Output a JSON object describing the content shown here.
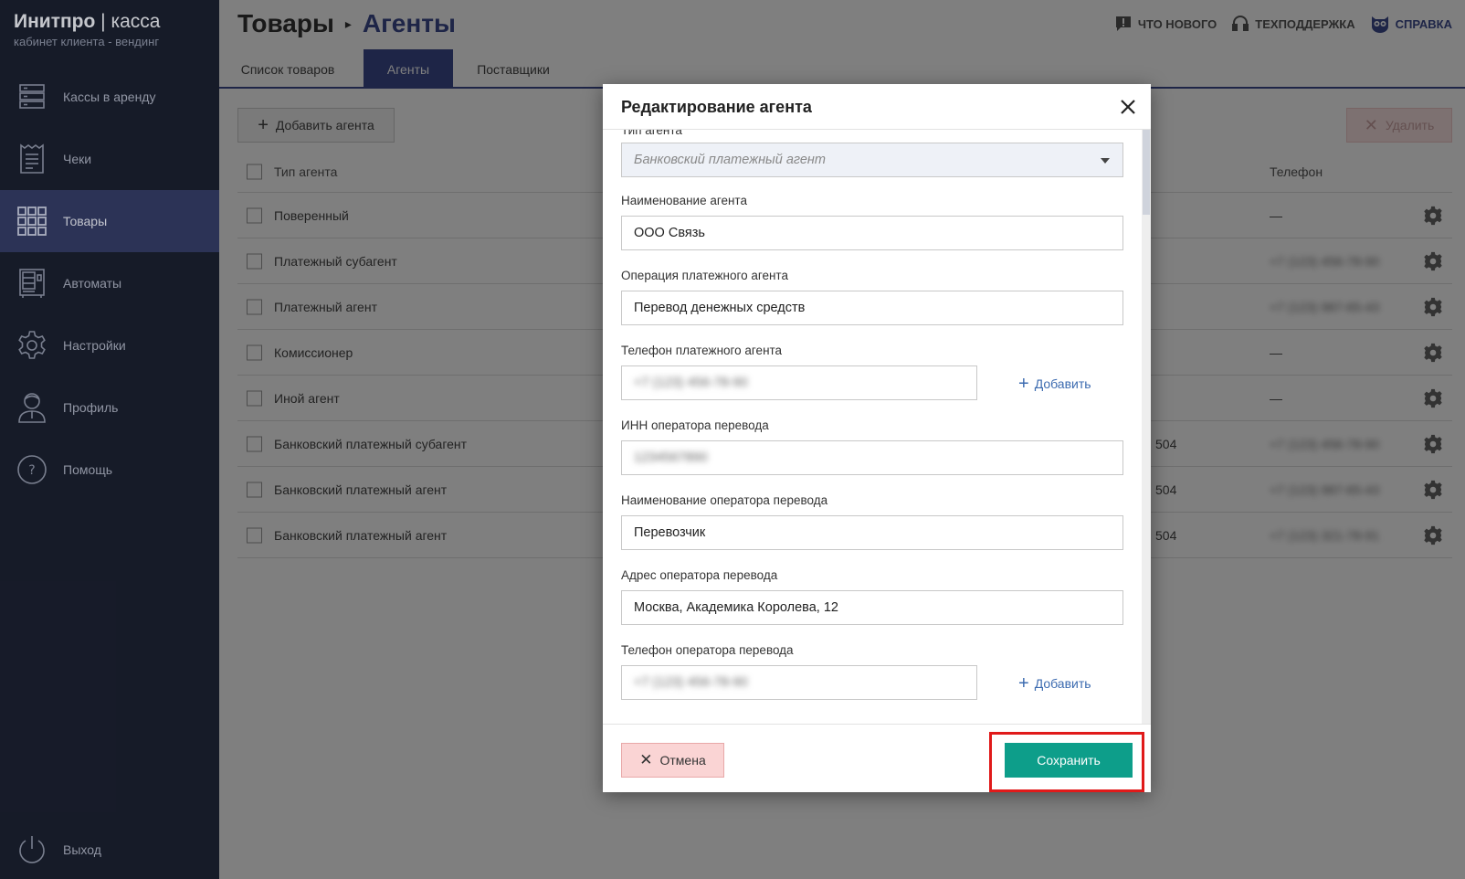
{
  "brand": {
    "name": "Инитпро",
    "sep": "|",
    "product": "касса",
    "subtitle": "кабинет клиента - вендинг"
  },
  "sidebar": {
    "items": [
      {
        "label": "Кассы в аренду",
        "icon": "server-icon"
      },
      {
        "label": "Чеки",
        "icon": "receipt-icon"
      },
      {
        "label": "Товары",
        "icon": "grid-icon"
      },
      {
        "label": "Автоматы",
        "icon": "vending-machine-icon"
      },
      {
        "label": "Настройки",
        "icon": "gear-icon"
      },
      {
        "label": "Профиль",
        "icon": "user-icon"
      },
      {
        "label": "Помощь",
        "icon": "help-icon"
      }
    ],
    "logout": "Выход"
  },
  "header": {
    "section": "Товары",
    "page": "Агенты",
    "links": {
      "news": "ЧТО НОВОГО",
      "support": "ТЕХПОДДЕРЖКА",
      "help": "СПРАВКА"
    }
  },
  "tabs": [
    "Список товаров",
    "Агенты",
    "Поставщики"
  ],
  "toolbar": {
    "add": "Добавить агента",
    "delete": "Удалить"
  },
  "table": {
    "headers": {
      "type": "Тип агента",
      "phone": "Телефон"
    },
    "rows": [
      {
        "type": "Поверенный",
        "code": "",
        "phone": "—"
      },
      {
        "type": "Платежный субагент",
        "code": "",
        "phone": "+7 (123) 456-78-90"
      },
      {
        "type": "Платежный агент",
        "code": "",
        "phone": "+7 (123) 987-65-43"
      },
      {
        "type": "Комиссионер",
        "code": "",
        "phone": "—"
      },
      {
        "type": "Иной агент",
        "code": "",
        "phone": "—"
      },
      {
        "type": "Банковский платежный субагент",
        "code": "504",
        "phone": "+7 (123) 456-78-90"
      },
      {
        "type": "Банковский платежный агент",
        "code": "504",
        "phone": "+7 (123) 987-65-43"
      },
      {
        "type": "Банковский платежный агент",
        "code": "504",
        "phone": "+7 (123) 321-78-91"
      }
    ]
  },
  "modal": {
    "title": "Редактирование агента",
    "agent_type_label": "Тип агента",
    "agent_type_value": "Банковский платежный агент",
    "name_label": "Наименование агента",
    "name_value": "ООО Связь",
    "operation_label": "Операция платежного агента",
    "operation_value": "Перевод денежных средств",
    "agent_phone_label": "Телефон платежного агента",
    "agent_phone_value": "+7 (123) 456-78-90",
    "inn_label": "ИНН оператора перевода",
    "inn_value": "1234567890",
    "operator_name_label": "Наименование оператора перевода",
    "operator_name_value": "Перевозчик",
    "operator_address_label": "Адрес оператора перевода",
    "operator_address_value": "Москва, Академика Королева, 12",
    "operator_phone_label": "Телефон оператора перевода",
    "operator_phone_value": "+7 (123) 456-78-90",
    "add_label": "Добавить",
    "cancel_label": "Отмена",
    "save_label": "Сохранить"
  },
  "colors": {
    "sidebar_bg": "#1b2030",
    "accent": "#3c4a8e",
    "save": "#0d9e8a",
    "highlight": "#e01a1a"
  }
}
